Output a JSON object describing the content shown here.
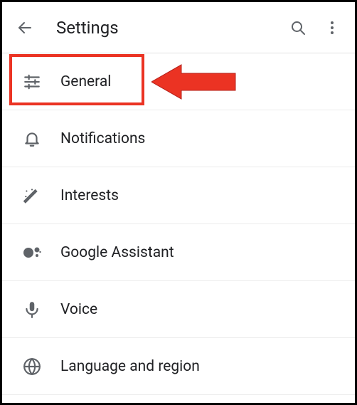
{
  "header": {
    "title": "Settings"
  },
  "items": [
    {
      "label": "General"
    },
    {
      "label": "Notifications"
    },
    {
      "label": "Interests"
    },
    {
      "label": "Google Assistant"
    },
    {
      "label": "Voice"
    },
    {
      "label": "Language and region"
    }
  ],
  "annotation": {
    "highlight_color": "#eb3323",
    "arrow_color": "#eb3323"
  }
}
